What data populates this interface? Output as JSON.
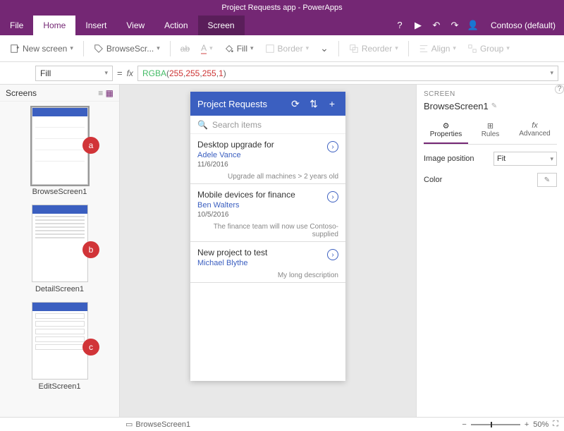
{
  "title": "Project Requests app - PowerApps",
  "menu": {
    "file": "File",
    "home": "Home",
    "insert": "Insert",
    "view": "View",
    "action": "Action",
    "screen": "Screen",
    "account": "Contoso (default)"
  },
  "ribbon": {
    "newscreen": "New screen",
    "browsescr": "BrowseScr...",
    "fill": "Fill",
    "border": "Border",
    "reorder": "Reorder",
    "align": "Align",
    "group": "Group"
  },
  "formula": {
    "prop": "Fill",
    "fn": "RGBA",
    "args": [
      "255",
      "255",
      "255",
      "1"
    ]
  },
  "screens": {
    "header": "Screens",
    "items": [
      {
        "label": "BrowseScreen1",
        "badge": "a"
      },
      {
        "label": "DetailScreen1",
        "badge": "b"
      },
      {
        "label": "EditScreen1",
        "badge": "c"
      }
    ]
  },
  "phone": {
    "title": "Project Requests",
    "search_placeholder": "Search items",
    "items": [
      {
        "title": "Desktop upgrade for",
        "person": "Adele Vance",
        "date": "11/6/2016",
        "desc": "Upgrade all machines > 2 years old"
      },
      {
        "title": "Mobile devices for finance",
        "person": "Ben Walters",
        "date": "10/5/2016",
        "desc": "The finance team will now use Contoso-supplied"
      },
      {
        "title": "New project to test",
        "person": "Michael Blythe",
        "date": "",
        "desc": "My long description"
      }
    ]
  },
  "props": {
    "section": "SCREEN",
    "screen_name": "BrowseScreen1",
    "tabs": {
      "properties": "Properties",
      "rules": "Rules",
      "advanced": "Advanced"
    },
    "image_position_label": "Image position",
    "image_position_value": "Fit",
    "color_label": "Color"
  },
  "status": {
    "screen": "BrowseScreen1",
    "zoom": "50%"
  }
}
